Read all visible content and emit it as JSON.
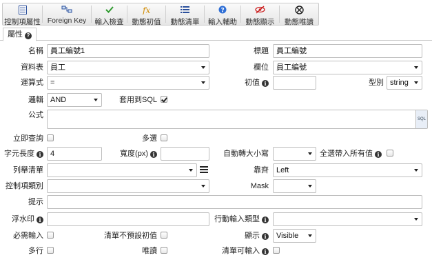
{
  "toolbar": [
    {
      "id": "control-props",
      "label": "控制項屬性",
      "icon": "properties-icon"
    },
    {
      "id": "foreign-key",
      "label": "Foreign Key",
      "icon": "foreign-key-icon"
    },
    {
      "id": "input-check",
      "label": "輸入檢查",
      "icon": "checkmark-icon"
    },
    {
      "id": "dynamic-initial",
      "label": "動態初值",
      "icon": "function-icon"
    },
    {
      "id": "dynamic-list",
      "label": "動態清單",
      "icon": "list-icon"
    },
    {
      "id": "input-help",
      "label": "輸入輔助",
      "icon": "help-icon"
    },
    {
      "id": "dynamic-display",
      "label": "動態顯示",
      "icon": "hidden-eye-icon"
    },
    {
      "id": "dynamic-readonly",
      "label": "動態唯讀",
      "icon": "no-edit-icon"
    }
  ],
  "tab": {
    "label": "屬性"
  },
  "form": {
    "name_label": "名稱",
    "name_value": "員工編號1",
    "title_label": "標題",
    "title_value": "員工編號",
    "table_label": "資料表",
    "table_value": "員工",
    "field_label": "欄位",
    "field_value": "員工編號",
    "operator_label": "運算式",
    "operator_value": "=",
    "initial_label": "初值",
    "initial_value": "",
    "type_label": "型別",
    "type_value": "string",
    "logic_label": "邏輯",
    "logic_value": "AND",
    "apply_sql_label": "套用到SQL",
    "apply_sql_checked": true,
    "formula_label": "公式",
    "formula_value": "",
    "sql_button": "SQL",
    "instant_query_label": "立即查詢",
    "instant_query_checked": false,
    "multi_select_label": "多選",
    "multi_select_checked": false,
    "char_length_label": "字元長度",
    "char_length_value": "4",
    "width_label": "寬度(px)",
    "width_value": "",
    "auto_case_label": "自動轉大小寫",
    "auto_case_value": "",
    "fill_all_label": "全選帶入所有值",
    "fill_all_checked": false,
    "enum_list_label": "列舉清單",
    "enum_list_value": "",
    "align_label": "靠齊",
    "align_value": "Left",
    "control_type_label": "控制項類別",
    "control_type_value": "",
    "mask_label": "Mask",
    "mask_value": "",
    "hint_label": "提示",
    "hint_value": "",
    "watermark_label": "浮水印",
    "watermark_value": "",
    "mobile_input_label": "行動輸入類型",
    "mobile_input_value": "",
    "required_label": "必需輸入",
    "required_checked": false,
    "no_default_label": "清單不預設初值",
    "no_default_checked": false,
    "display_label": "顯示",
    "display_value": "Visible",
    "multiline_label": "多行",
    "multiline_checked": false,
    "readonly_label": "唯讀",
    "readonly_checked": false,
    "list_input_label": "清單可輸入",
    "list_input_checked": false
  },
  "colors": {
    "checkmark": "#2e9a2e",
    "function": "#d08a00",
    "list": "#2a4f9c",
    "help": "#2f6fd6",
    "hidden_eye": "#c22",
    "no_edit": "#222"
  }
}
